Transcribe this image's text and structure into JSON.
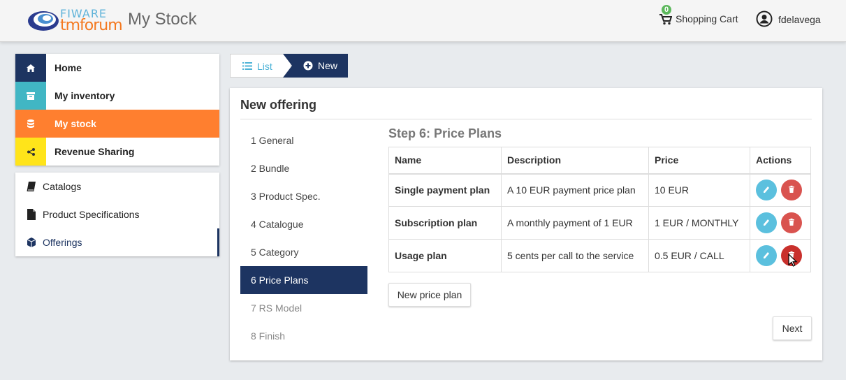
{
  "header": {
    "logo_top": "FIWARE",
    "logo_bottom": "tmforum",
    "app_title": "My Stock",
    "cart_count": "0",
    "cart_label": "Shopping Cart",
    "user_name": "fdelavega"
  },
  "sidebar": {
    "main": [
      {
        "label": "Home",
        "icon": "home-icon",
        "color": "#1d3461"
      },
      {
        "label": "My inventory",
        "icon": "archive-icon",
        "color": "#41b6c4"
      },
      {
        "label": "My stock",
        "icon": "database-icon",
        "color": "#ff7f2f",
        "active": true
      },
      {
        "label": "Revenue Sharing",
        "icon": "share-icon",
        "color": "#ffe41a"
      }
    ],
    "sub": [
      {
        "label": "Catalogs",
        "icon": "book-icon"
      },
      {
        "label": "Product Specifications",
        "icon": "file-icon"
      },
      {
        "label": "Offerings",
        "icon": "cube-icon",
        "active": true
      }
    ]
  },
  "breadcrumb": {
    "list_label": "List",
    "new_label": "New"
  },
  "card": {
    "title": "New offering",
    "steps": [
      "1 General",
      "2 Bundle",
      "3 Product Spec.",
      "4 Catalogue",
      "5 Category",
      "6 Price Plans",
      "7 RS Model",
      "8 Finish"
    ],
    "active_step": 5,
    "step_title": "Step 6: Price Plans",
    "table": {
      "headers": [
        "Name",
        "Description",
        "Price",
        "Actions"
      ],
      "rows": [
        {
          "name": "Single payment plan",
          "description": "A 10 EUR payment price plan",
          "price": "10 EUR"
        },
        {
          "name": "Subscription plan",
          "description": "A monthly payment of 1 EUR",
          "price": "1 EUR / MONTHLY"
        },
        {
          "name": "Usage plan",
          "description": "5 cents per call to the service",
          "price": "0.5 EUR / CALL"
        }
      ]
    },
    "new_plan_button": "New price plan",
    "next_button": "Next"
  },
  "colors": {
    "navy": "#1d3461",
    "orange": "#ff7f2f",
    "teal": "#41b6c4",
    "yellow": "#ffe41a",
    "edit": "#5bc0de",
    "delete": "#d9534f"
  }
}
